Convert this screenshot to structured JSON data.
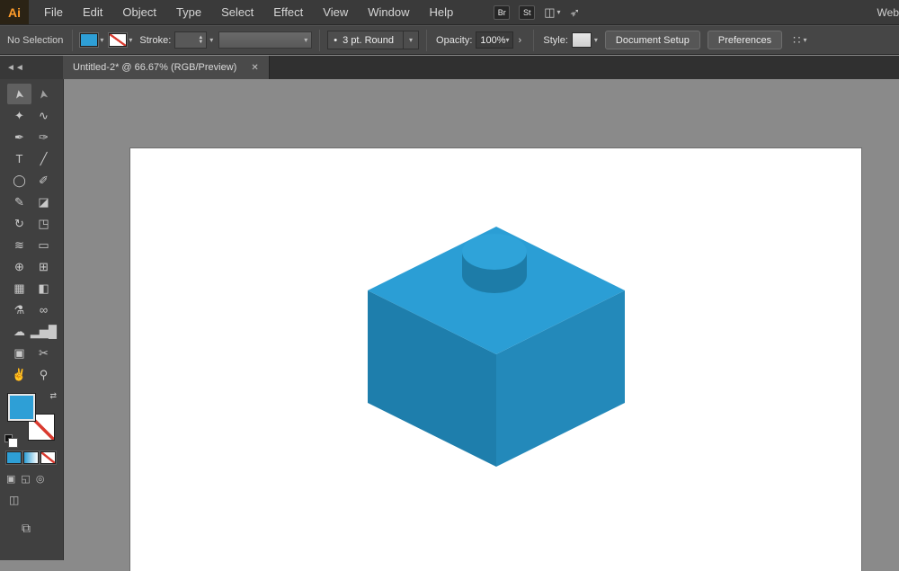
{
  "app": {
    "logo": "Ai",
    "workspace": "Web"
  },
  "menu": {
    "items": [
      "File",
      "Edit",
      "Object",
      "Type",
      "Select",
      "Effect",
      "View",
      "Window",
      "Help"
    ],
    "bridge_badge": "Br",
    "stock_badge": "St"
  },
  "icons": {
    "caret": "▾",
    "double_caret": "◄◄",
    "swap": "⇄",
    "spin_up": "▲",
    "spin_down": "▼",
    "chevron": "›",
    "close": "✕",
    "align": "∷",
    "grid": "◫",
    "rocket": "➳",
    "monitor": "⧉",
    "screen_mode": "◫",
    "mode_normal": "▣",
    "mode_behind": "◱",
    "mode_inside": "◎"
  },
  "control_bar": {
    "selection_status": "No Selection",
    "stroke_label": "Stroke:",
    "brush_bullet": "•",
    "brush_preset": "3 pt. Round",
    "opacity_label": "Opacity:",
    "opacity_value": "100%",
    "style_label": "Style:",
    "document_setup": "Document Setup",
    "preferences": "Preferences"
  },
  "tab": {
    "title": "Untitled-2* @ 66.67% (RGB/Preview)"
  },
  "tools": [
    {
      "name": "selection",
      "glyph": "➤",
      "active": true
    },
    {
      "name": "direct-selection",
      "glyph": "➤"
    },
    {
      "name": "magic-wand",
      "glyph": "✦"
    },
    {
      "name": "lasso",
      "glyph": "∿"
    },
    {
      "name": "pen",
      "glyph": "✒"
    },
    {
      "name": "curvature",
      "glyph": "✑"
    },
    {
      "name": "type",
      "glyph": "T"
    },
    {
      "name": "line-segment",
      "glyph": "╱"
    },
    {
      "name": "ellipse",
      "glyph": "◯"
    },
    {
      "name": "paintbrush",
      "glyph": "✐"
    },
    {
      "name": "pencil",
      "glyph": "✎"
    },
    {
      "name": "eraser",
      "glyph": "◪"
    },
    {
      "name": "rotate",
      "glyph": "↻"
    },
    {
      "name": "scale",
      "glyph": "◳"
    },
    {
      "name": "width",
      "glyph": "≋"
    },
    {
      "name": "free-transform",
      "glyph": "▭"
    },
    {
      "name": "shape-builder",
      "glyph": "⊕"
    },
    {
      "name": "perspective-grid",
      "glyph": "⊞"
    },
    {
      "name": "mesh",
      "glyph": "▦"
    },
    {
      "name": "gradient",
      "glyph": "◧"
    },
    {
      "name": "eyedropper",
      "glyph": "⚗"
    },
    {
      "name": "blend",
      "glyph": "∞"
    },
    {
      "name": "symbol-sprayer",
      "glyph": "☁"
    },
    {
      "name": "column-graph",
      "glyph": "▂▅█"
    },
    {
      "name": "artboard",
      "glyph": "▣"
    },
    {
      "name": "slice",
      "glyph": "✂"
    },
    {
      "name": "hand",
      "glyph": "✌"
    },
    {
      "name": "zoom",
      "glyph": "⚲"
    }
  ],
  "colors": {
    "fill": "#2E9FD6",
    "stroke": "none",
    "brick_top": "#2B9ED5",
    "brick_left": "#1E7EAC",
    "brick_right": "#2389BA",
    "stud_top": "#2FA3D9",
    "stud_side": "#1D7CA8",
    "canvas_bg": "#8A8A8A",
    "ui_dark": "#3A3A3A"
  }
}
